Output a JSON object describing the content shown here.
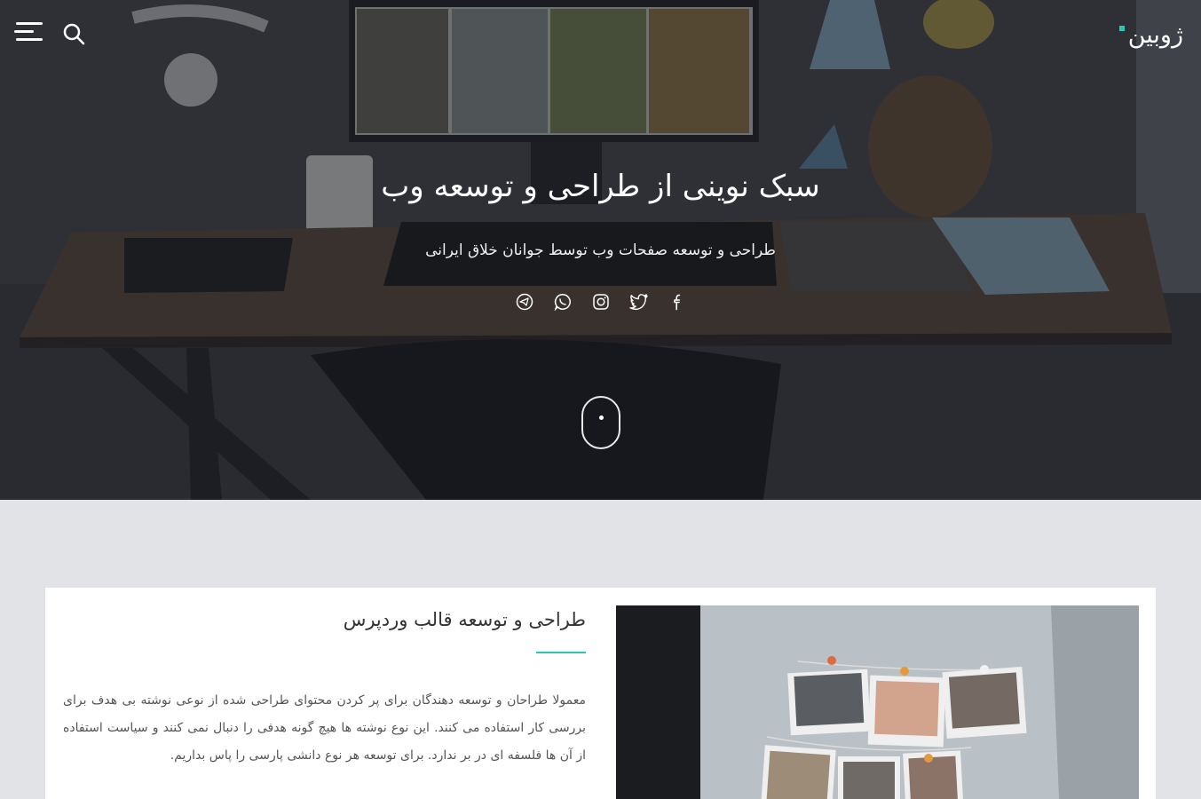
{
  "header": {
    "brand": "ژوبین",
    "menu_icon": "hamburger-menu-icon",
    "search_icon": "search-icon"
  },
  "hero": {
    "title": "سبک نوینی از طراحی و توسعه وب",
    "subtitle": "طراحی و توسعه صفحات وب توسط جوانان خلاق ایرانی",
    "socials": [
      {
        "icon": "telegram-icon"
      },
      {
        "icon": "whatsapp-icon"
      },
      {
        "icon": "instagram-icon"
      },
      {
        "icon": "twitter-icon"
      },
      {
        "icon": "facebook-icon"
      }
    ],
    "scroll_icon": "scroll-mouse-icon"
  },
  "post": {
    "title": "طراحی و توسعه قالب وردپرس",
    "body": "معمولا طراحان و توسعه دهندگان برای پر کردن محتوای طراحی شده از نوعی نوشته بی هدف برای بررسی کار استفاده می کنند. این نوع نوشته ها هیچ گونه هدفی را دنبال نمی کنند و سیاست استفاده از آن ها فلسفه ای در بر ندارد. برای توسعه هر نوع دانشی پارسی را پاس بداریم."
  },
  "colors": {
    "accent": "#2ec4b6",
    "page_background": "#e1e3e6",
    "card_background": "#ffffff"
  }
}
